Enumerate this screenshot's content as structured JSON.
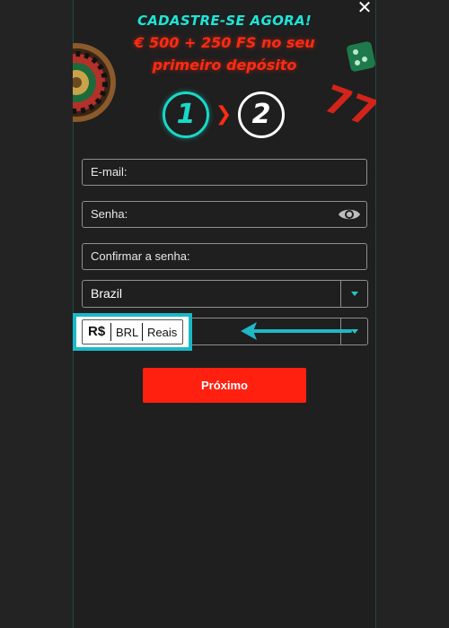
{
  "header": {
    "title": "CADASTRE-SE AGORA!",
    "bonus_line1": "€ 500 + 250 FS no seu",
    "bonus_line2": "primeiro depósito"
  },
  "steps": {
    "step1": "1",
    "step2": "2",
    "active_step": 1
  },
  "form": {
    "email_placeholder": "E-mail:",
    "password_placeholder": "Senha:",
    "confirm_placeholder": "Confirmar a senha:",
    "country_value": "Brazil",
    "currency": {
      "symbol": "R$",
      "code": "BRL",
      "name": "Reais"
    }
  },
  "buttons": {
    "next_label": "Próximo",
    "close_label": "✕"
  },
  "colors": {
    "accent_teal": "#19d8c8",
    "cta_red": "#ff2010",
    "background": "#1f1f1f"
  },
  "icons": [
    "close-icon",
    "eye-icon",
    "chevron-down-icon",
    "arrow-left-icon",
    "roulette-wheel-icon",
    "slot-dice-icon"
  ]
}
